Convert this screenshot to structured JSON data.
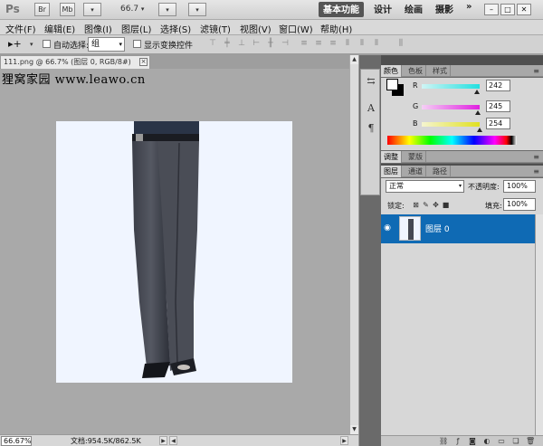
{
  "app": {
    "logo": "Ps",
    "bridge_button": "Br",
    "minibridge_button": "Mb",
    "zoom_level": "66.7",
    "workspaces": [
      "基本功能",
      "设计",
      "绘画",
      "摄影"
    ],
    "overflow": "»",
    "window_controls": [
      "–",
      "□",
      "✕"
    ]
  },
  "menu": [
    "文件(F)",
    "编辑(E)",
    "图像(I)",
    "图层(L)",
    "选择(S)",
    "滤镜(T)",
    "视图(V)",
    "窗口(W)",
    "帮助(H)"
  ],
  "options": {
    "auto_select_label": "自动选择:",
    "auto_select_value": "组",
    "show_transform_label": "显示变换控件"
  },
  "document": {
    "tab_title": "111.png @ 66.7% (图层 0, RGB/8#)",
    "close": "×",
    "watermark": "狸窝家园 www.leawo.cn"
  },
  "status": {
    "zoom": "66.67%",
    "doc_info": "文档:954.5K/862.5K",
    "next": "▶"
  },
  "color_panel": {
    "tabs": [
      "颜色",
      "色板",
      "样式"
    ],
    "channels": [
      {
        "label": "R",
        "value": "242",
        "fraction": 0.949,
        "color_from": "#d0f5f5",
        "color_to": "#22e0e0"
      },
      {
        "label": "G",
        "value": "245",
        "fraction": 0.961,
        "color_from": "#f5d0f5",
        "color_to": "#e020e0"
      },
      {
        "label": "B",
        "value": "254",
        "fraction": 0.996,
        "color_from": "#f5f5d0",
        "color_to": "#e0e020"
      }
    ],
    "foreground_color": "#ffffff",
    "background_color": "#000000"
  },
  "adjust_panel": {
    "tabs": [
      "调整",
      "蒙版"
    ]
  },
  "layers_panel": {
    "tabs": [
      "图层",
      "通道",
      "路径"
    ],
    "blend_mode": "正常",
    "opacity_label": "不透明度:",
    "opacity_value": "100%",
    "lock_label": "锁定:",
    "fill_label": "填充:",
    "fill_value": "100%",
    "layers": [
      {
        "name": "图层 0",
        "selected": true,
        "visible": true
      }
    ],
    "footer_icons": [
      "link-icon",
      "fx-icon",
      "mask-icon",
      "adjustment-icon",
      "group-icon",
      "new-layer-icon",
      "trash-icon"
    ]
  },
  "mid_dock": {
    "icons": [
      "paragraph-style-icon",
      "character-icon",
      "paragraph-icon"
    ]
  },
  "colors": {
    "selected_layer": "#0f6ab4",
    "canvas_bg": "#f0f5ff"
  }
}
